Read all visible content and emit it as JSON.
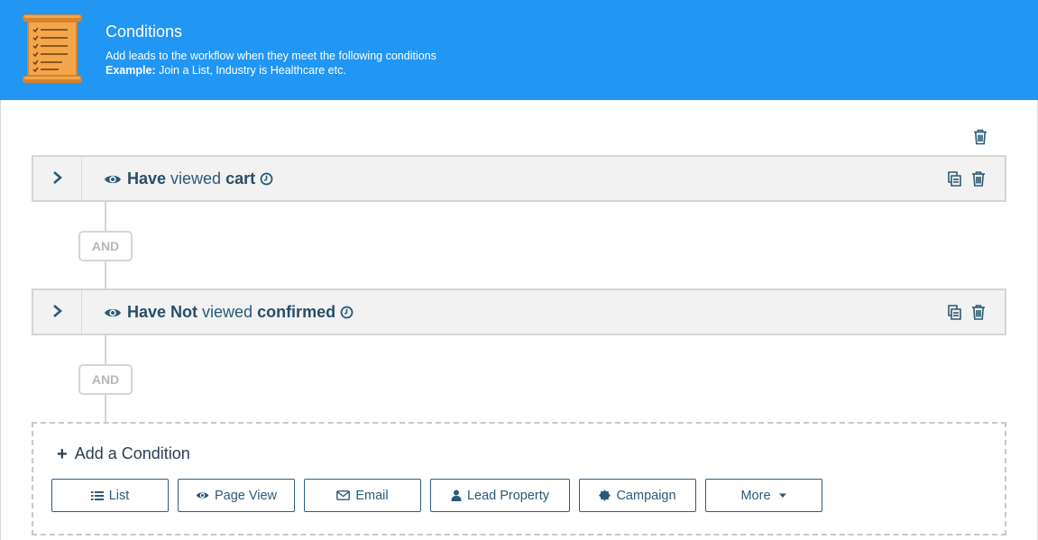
{
  "header": {
    "title": "Conditions",
    "description": "Add leads to the workflow when they meet the following conditions",
    "example_label": "Example:",
    "example_text": " Join a List, Industry is Healthcare etc.",
    "background_color": "#2196f3",
    "icon": "scroll-checklist-icon"
  },
  "conditions": [
    {
      "prefix": "Have",
      "verb": "viewed",
      "target": "cart",
      "icons": [
        "eye-icon",
        "clock-icon",
        "copy-icon",
        "trash-icon",
        "chevron-right-icon"
      ]
    },
    {
      "prefix": "Have Not",
      "verb": "viewed",
      "target": "confirmed",
      "icons": [
        "eye-icon",
        "clock-icon",
        "copy-icon",
        "trash-icon",
        "chevron-right-icon"
      ]
    }
  ],
  "connectors": [
    "AND",
    "AND"
  ],
  "add_condition": {
    "label": "Add a Condition",
    "buttons": [
      {
        "label": "List",
        "icon": "list-icon"
      },
      {
        "label": "Page View",
        "icon": "eye-icon"
      },
      {
        "label": "Email",
        "icon": "envelope-icon"
      },
      {
        "label": "Lead Property",
        "icon": "user-icon"
      },
      {
        "label": "Campaign",
        "icon": "badge-icon"
      },
      {
        "label": "More",
        "icon": "caret-down-icon"
      }
    ]
  },
  "colors": {
    "accent": "#2196f3",
    "text_dark": "#274e68",
    "row_background": "#f2f2f2",
    "border": "#d5d5d5"
  }
}
